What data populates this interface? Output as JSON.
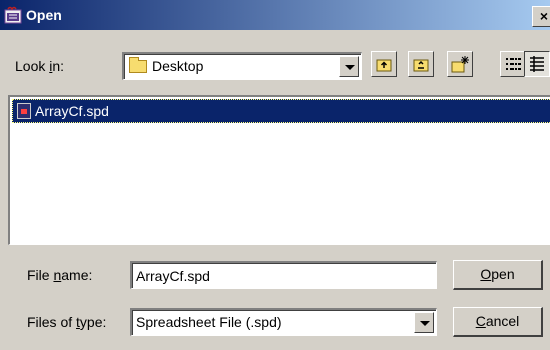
{
  "window": {
    "title": "Open",
    "close_glyph": "×"
  },
  "look_in": {
    "label_pre": "Look ",
    "label_mn": "i",
    "label_post": "n:",
    "value": "Desktop",
    "icon": "folder-icon"
  },
  "toolbar": {
    "buttons": [
      {
        "name": "up-one-level-button",
        "icon": "up-folder-icon"
      },
      {
        "name": "home-button",
        "icon": "home-folder-icon"
      },
      {
        "name": "new-folder-button",
        "icon": "new-folder-icon"
      },
      {
        "name": "list-view-button",
        "icon": "list-view-icon"
      },
      {
        "name": "details-view-button",
        "icon": "details-view-icon"
      }
    ]
  },
  "files": [
    {
      "name": "ArrayCf.spd",
      "icon": "spreadsheet-file-icon",
      "selected": true
    }
  ],
  "file_name": {
    "label_pre": "File ",
    "label_mn": "n",
    "label_post": "ame:",
    "value": "ArrayCf.spd"
  },
  "file_type": {
    "label_pre": "Files of ",
    "label_mn": "t",
    "label_post": "ype:",
    "value": "Spreadsheet File (.spd)"
  },
  "buttons": {
    "open": {
      "mn": "O",
      "rest": "pen"
    },
    "cancel": {
      "mn": "C",
      "rest": "ancel"
    }
  },
  "colors": {
    "titlebar_start": "#0a246a",
    "titlebar_end": "#a6caf0",
    "selection": "#0a246a",
    "face": "#d4d0c8"
  }
}
